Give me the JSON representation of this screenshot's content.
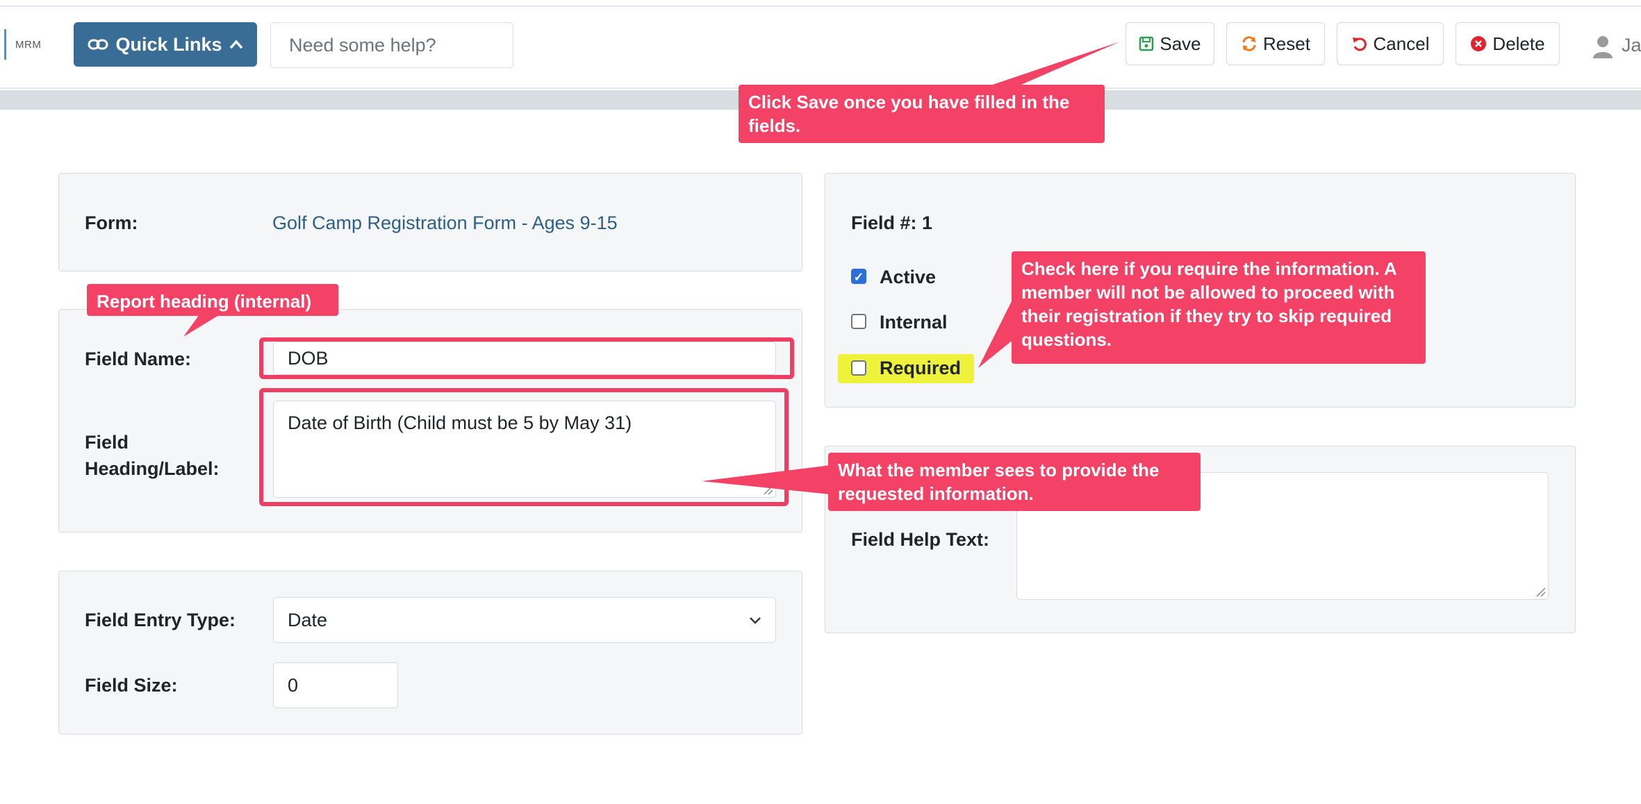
{
  "header": {
    "logo": "MRM",
    "quick_links_label": "Quick Links",
    "help_placeholder": "Need some help?",
    "save_label": "Save",
    "reset_label": "Reset",
    "cancel_label": "Cancel",
    "delete_label": "Delete",
    "user_name": "Ja"
  },
  "form_panel": {
    "form_label": "Form:",
    "form_value": "Golf Camp Registration Form - Ages 9-15"
  },
  "name_panel": {
    "field_name_label": "Field Name:",
    "field_name_value": "DOB",
    "heading_label": "Field Heading/Label:",
    "heading_value": "Date of Birth (Child must be 5 by May 31)"
  },
  "entry_panel": {
    "entry_type_label": "Field Entry Type:",
    "entry_type_value": "Date",
    "size_label": "Field Size:",
    "size_value": "0"
  },
  "options_panel": {
    "field_number": "Field #: 1",
    "active_label": "Active",
    "internal_label": "Internal",
    "required_label": "Required",
    "active_checked": true,
    "internal_checked": false,
    "required_checked": false
  },
  "help_panel": {
    "help_text_label": "Field Help Text:",
    "help_text_value": ""
  },
  "callouts": {
    "save": "Click Save once you have filled in the fields.",
    "report_heading": "Report heading (internal)",
    "required": "Check here if you require the information. A member will not be allowed to proceed with their registration if they try to skip required questions.",
    "label": "What the member sees to provide the requested information."
  },
  "colors": {
    "accent": "#3a6d95",
    "callout": "#f34266",
    "highlight": "#eef23a"
  }
}
